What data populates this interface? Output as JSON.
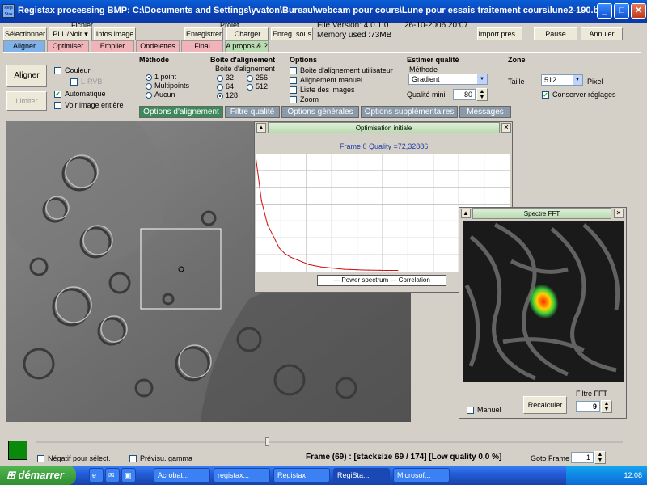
{
  "window": {
    "title": "Registax processing BMP: C:\\Documents and Settings\\yvaton\\Bureau\\webcam pour cours\\Lune pour essais traitement cours\\lune2-190.bmp",
    "icon_text": "Regi Stax"
  },
  "toolbar": {
    "select": "Sélectionner",
    "fichier_label": "Fichier",
    "plu_noir": "PLU/Noir ▾",
    "infos_image": "Infos image",
    "projet_label": "Projet",
    "enregistrer": "Enregistrer",
    "charger": "Charger",
    "enreg_sous": "Enreg. sous",
    "file_version": "File Version: 4.0.1.0",
    "date": "26-10-2006 20:07",
    "memory": "Memory used :73MB",
    "import_pres": "Import pres...",
    "pause": "Pause",
    "annuler": "Annuler"
  },
  "tabs": [
    "Aligner",
    "Optimiser",
    "Empiler",
    "Ondelettes",
    "Final",
    "A propos & ?"
  ],
  "left": {
    "aligner": "Aligner",
    "limiter": "Limiter",
    "couleur": "Couleur",
    "lrvb": "L-RVB",
    "automatique": "Automatique",
    "voir_image": "Voir image entière"
  },
  "methode": {
    "title": "Méthode",
    "options": [
      "1 point",
      "Multipoints",
      "Aucun"
    ]
  },
  "boite": {
    "title": "Boite d'alignement",
    "subtitle": "Boite d'alignement",
    "options": [
      "32",
      "256",
      "64",
      "512",
      "128"
    ]
  },
  "options": {
    "title": "Options",
    "items": [
      "Boite d'alignement utilisateur",
      "Alignement manuel",
      "Liste des images",
      "Zoom"
    ]
  },
  "qualite": {
    "title": "Estimer qualité",
    "methode": "Méthode",
    "method_value": "Gradient",
    "qualite_mini": "Qualité mini",
    "qualite_value": "80"
  },
  "zone": {
    "title": "Zone",
    "taille": "Taille",
    "taille_value": "512",
    "pixel": "Pixel",
    "conserver": "Conserver réglages"
  },
  "subtabs": [
    "Options d'alignement",
    "Filtre qualité",
    "Options générales",
    "Options supplémentaires",
    "Messages"
  ],
  "optim": {
    "title": "Optimisation initiale",
    "frame_quality": "Frame 0 Quality =72,32886",
    "legend": "— Power spectrum — Correlation",
    "chart_data": {
      "type": "line",
      "series": [
        {
          "name": "Power spectrum",
          "values": [
            0.98,
            0.6,
            0.4,
            0.3,
            0.2,
            0.15,
            0.12,
            0.1,
            0.08,
            0.06,
            0.05,
            0.04,
            0.035,
            0.03,
            0.025,
            0.02,
            0.018,
            0.016,
            0.014,
            0.013,
            0.012,
            0.011,
            0.01,
            0.01,
            0.01
          ]
        },
        {
          "name": "Correlation",
          "values": []
        }
      ],
      "grid": true,
      "color": "#cc1010"
    }
  },
  "fft": {
    "title": "Spectre FFT",
    "manuel": "Manuel",
    "recalculer": "Recalculer",
    "filtre_label": "Filtre FFT",
    "filtre_value": "9"
  },
  "bottom": {
    "negatif": "Négatif pour sélect.",
    "previsu": "Prévisu. gamma",
    "frame_status": "Frame (69) :  [stacksize 69 / 174]  [Low quality 0,0 %]",
    "goto_frame": "Goto Frame",
    "goto_value": "1"
  },
  "taskbar": {
    "start": "démarrer",
    "tasks": [
      "Acrobat...",
      "registax...",
      "Registax",
      "RegiSta...",
      "Microsof..."
    ],
    "clock": "12:08"
  },
  "colors": {
    "accent_green": "#0a8a0a",
    "title_blue": "#0b3fb0"
  }
}
